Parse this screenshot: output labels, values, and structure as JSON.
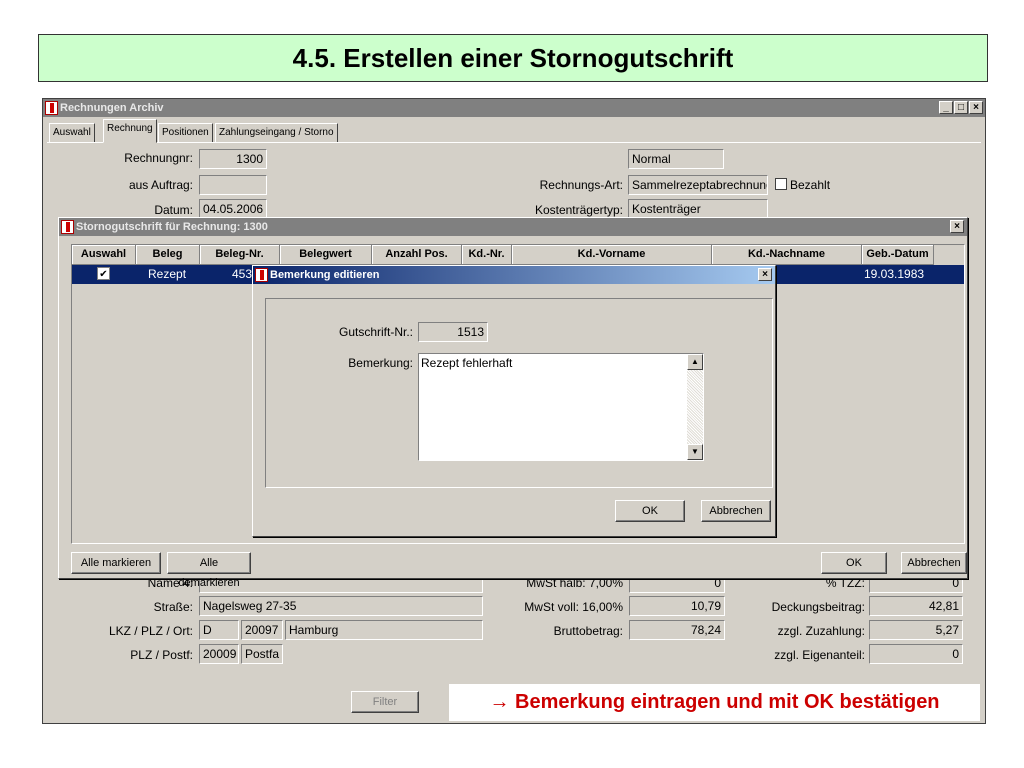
{
  "slide": {
    "title": "4.5. Erstellen einer Stornogutschrift",
    "caption": "→ Bemerkung eintragen und mit OK bestätigen"
  },
  "main_window": {
    "title": "Rechnungen Archiv",
    "tabs": [
      "Auswahl",
      "Rechnung",
      "Positionen",
      "Zahlungseingang / Storno"
    ],
    "labels": {
      "rechnungsnr": "Rechnungnr:",
      "auftrag": "aus Auftrag:",
      "datum": "Datum:",
      "rechnungsart": "Rechnungs-Art:",
      "kostentraegertyp": "Kostenträgertyp:",
      "bezahlt": "Bezahlt",
      "name4": "Name 4:",
      "strasse": "Straße:",
      "lkz": "LKZ / PLZ / Ort:",
      "postf": "PLZ / Postf:",
      "mwst_halb": "MwSt halb:  7,00%",
      "mwst_voll": "MwSt voll:  16,00%",
      "brutto": "Bruttobetrag:",
      "tzz": "% TZZ:",
      "deckung": "Deckungsbeitrag:",
      "zuzahlung": "zzgl. Zuzahlung:",
      "eigenanteil": "zzgl. Eigenanteil:"
    },
    "values": {
      "rechnungsnr": "1300",
      "auftrag": "",
      "datum": "04.05.2006",
      "status": "Normal",
      "rechnungsart": "Sammelrezeptabrechnung",
      "kostentraegertyp": "Kostenträger",
      "strasse": "Nagelsweg 27-35",
      "lkz": "D",
      "plz": "20097",
      "ort": "Hamburg",
      "postf_plz": "20009",
      "postf": "Postfa",
      "mwst_halb": "0",
      "mwst_voll": "10,79",
      "brutto": "78,24",
      "tzz": "0",
      "deckung": "42,81",
      "zuzahlung": "5,27",
      "eigenanteil": "0"
    },
    "filter_label": "Filter"
  },
  "storno_window": {
    "title": "Stornogutschrift für Rechnung: 1300",
    "columns": [
      "Auswahl",
      "Beleg",
      "Beleg-Nr.",
      "Belegwert",
      "Anzahl Pos.",
      "Kd.-Nr.",
      "Kd.-Vorname",
      "Kd.-Nachname",
      "Geb.-Datum"
    ],
    "row": {
      "auswahl": "✔",
      "beleg": "Rezept",
      "beleg_nr": "453",
      "geb_datum": "19.03.1983"
    },
    "btn_mark_all": "Alle markieren",
    "btn_unmark_all": "Alle demarkieren",
    "btn_ok": "OK",
    "btn_cancel": "Abbrechen"
  },
  "bemerkung_dialog": {
    "title": "Bemerkung editieren",
    "gutschrift_label": "Gutschrift-Nr.:",
    "gutschrift_value": "1513",
    "bemerkung_label": "Bemerkung:",
    "bemerkung_value": "Rezept fehlerhaft",
    "btn_ok": "OK",
    "btn_cancel": "Abbrechen"
  },
  "colors": {
    "slide_title_bg": "#ccffcc",
    "caption_text": "#cc0000",
    "selection": "#0a246a",
    "window_bg": "#d4d0c8"
  }
}
